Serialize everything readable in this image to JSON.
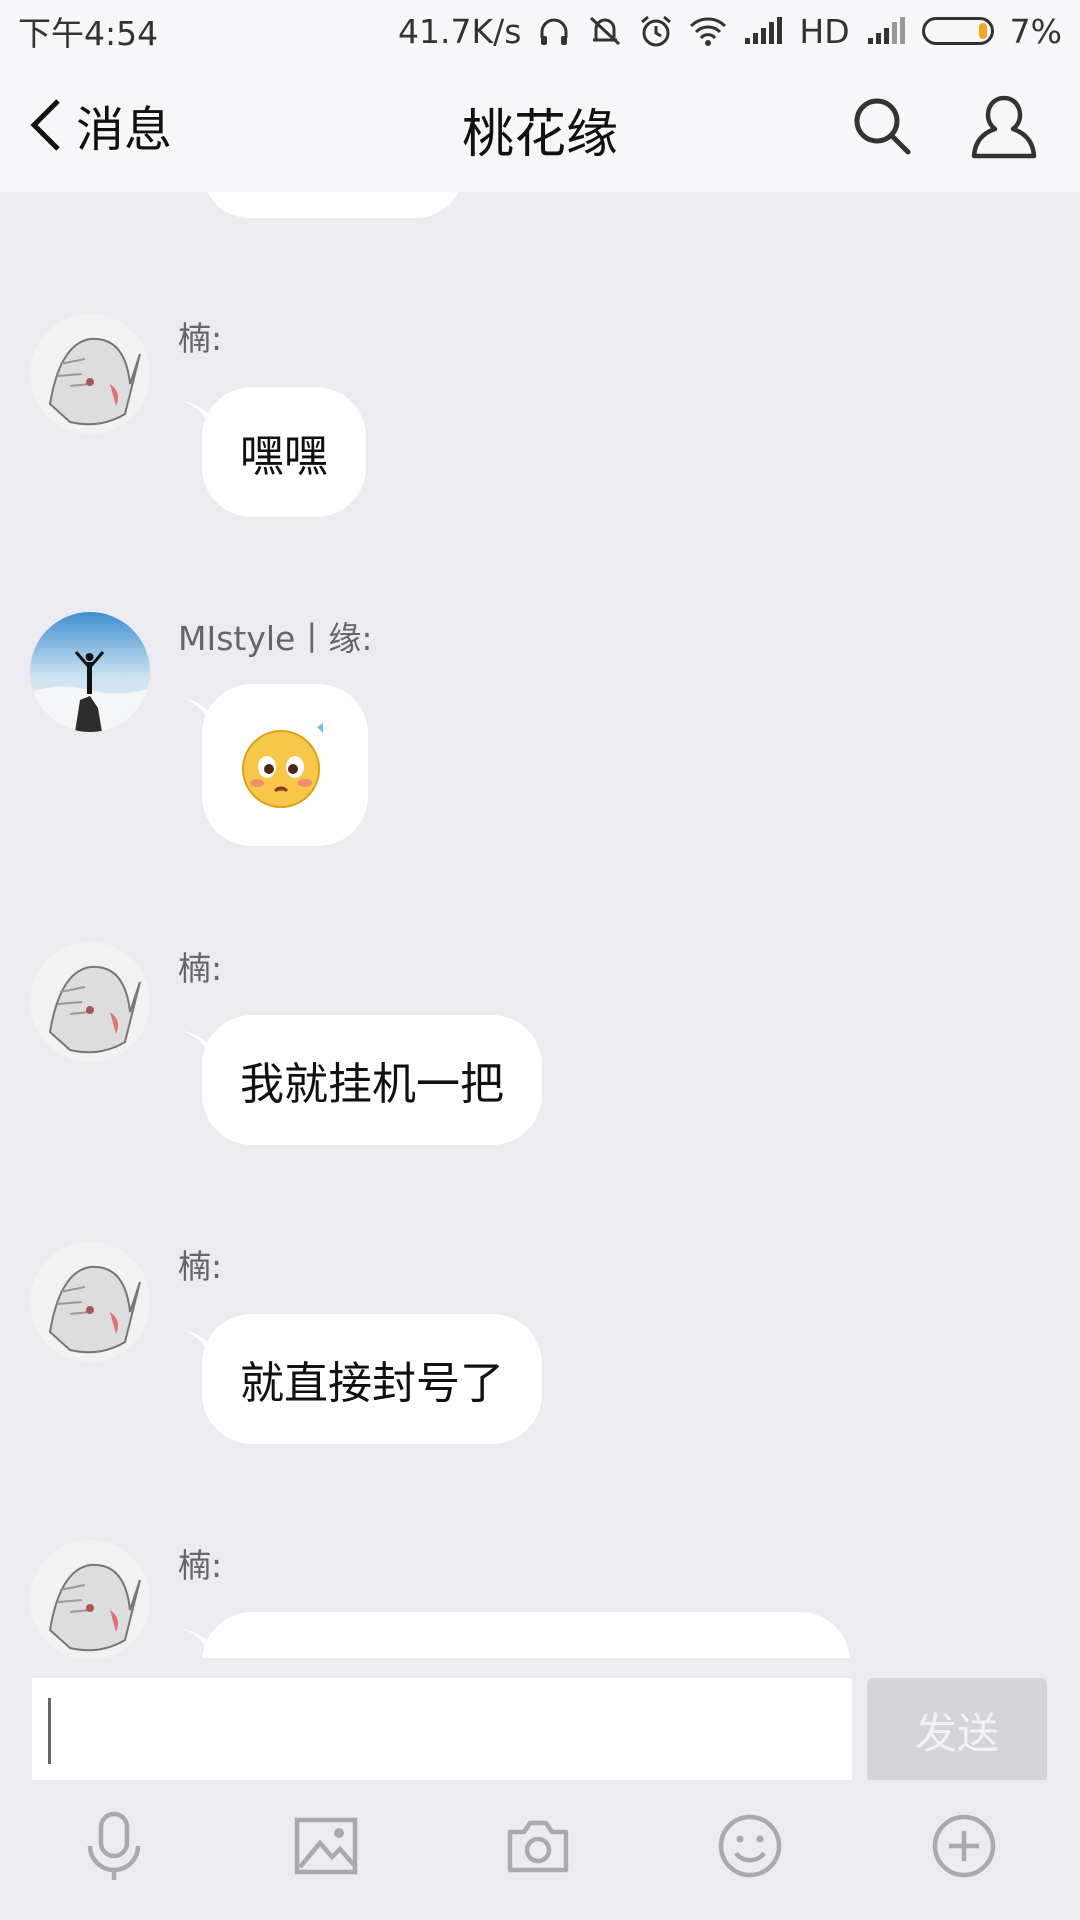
{
  "status_bar": {
    "time": "下午4:54",
    "speed": "41.7K/s",
    "hd": "HD",
    "battery_percent": "7%"
  },
  "nav": {
    "back_label": "消息",
    "title": "桃花缘"
  },
  "messages": [
    {
      "sender": "楠:",
      "text": "嘿嘿"
    },
    {
      "sender": "MIstyle丨缘:",
      "emoji": "shy-face-emoji"
    },
    {
      "sender": "楠:",
      "text": "我就挂机一把"
    },
    {
      "sender": "楠:",
      "text": "就直接封号了"
    },
    {
      "sender": "楠:",
      "text": ""
    }
  ],
  "input": {
    "value": "",
    "send_label": "发送"
  },
  "toolbar": {
    "icons": [
      "microphone-icon",
      "image-icon",
      "camera-icon",
      "emoji-icon",
      "plus-icon"
    ]
  },
  "colors": {
    "background": "#ebebf0",
    "bubble": "#ffffff",
    "send_disabled": "#d5d5d9",
    "battery_low": "#f5a623"
  }
}
